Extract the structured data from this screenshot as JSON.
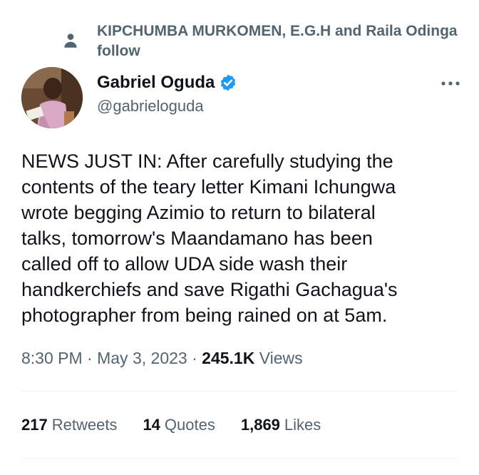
{
  "social_context": {
    "icon": "person-icon",
    "text": "KIPCHUMBA MURKOMEN, E.G.H and Raila Odinga follow"
  },
  "author": {
    "display_name": "Gabriel Oguda",
    "handle": "@gabrieloguda",
    "verified": true,
    "verified_color": "#1d9bf0"
  },
  "more_menu": {
    "icon": "more-horizontal-icon"
  },
  "tweet": {
    "text": "NEWS JUST IN: After carefully studying the\ncontents of the teary letter Kimani Ichungwa\nwrote begging Azimio to return to bilateral\ntalks, tomorrow's Maandamano has been\ncalled off to allow UDA side wash their\nhandkerchiefs and save Rigathi Gachagua's\nphotographer from being rained on at 5am."
  },
  "meta": {
    "time": "8:30 PM",
    "separator": "·",
    "date": "May 3, 2023",
    "views_count": "245.1K",
    "views_label": "Views"
  },
  "stats": [
    {
      "count": "217",
      "label": "Retweets"
    },
    {
      "count": "14",
      "label": "Quotes"
    },
    {
      "count": "1,869",
      "label": "Likes"
    }
  ],
  "colors": {
    "text_primary": "#0f1419",
    "text_secondary": "#536471",
    "accent": "#1d9bf0",
    "divider": "#eff3f4"
  }
}
